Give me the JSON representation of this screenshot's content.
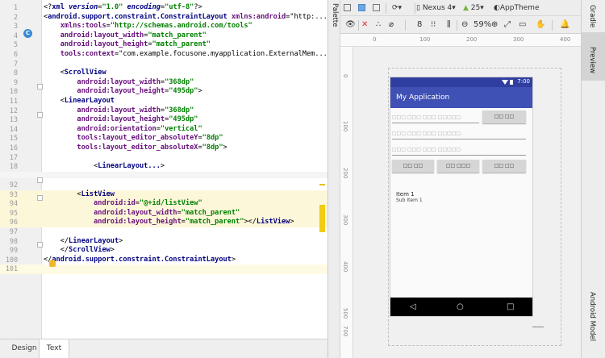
{
  "editor": {
    "lines": [
      {
        "n": "1",
        "code": "<?xml version=\"1.0\" encoding=\"utf-8\"?>"
      },
      {
        "n": "2",
        "code": "<android.support.constraint.ConstraintLayout xmlns:android=\"http:..."
      },
      {
        "n": "3",
        "code": "    xmlns:tools=\"http://schemas.android.com/tools\""
      },
      {
        "n": "4",
        "code": "    android:layout_width=\"match_parent\""
      },
      {
        "n": "5",
        "code": "    android:layout_height=\"match_parent\""
      },
      {
        "n": "6",
        "code": "    tools:context=\"com.example.focusone.myapplication.ExternalMem..."
      },
      {
        "n": "7",
        "code": ""
      },
      {
        "n": "8",
        "code": "    <ScrollView"
      },
      {
        "n": "9",
        "code": "        android:layout_width=\"368dp\""
      },
      {
        "n": "10",
        "code": "        android:layout_height=\"495dp\">"
      },
      {
        "n": "11",
        "code": "    <LinearLayout"
      },
      {
        "n": "12",
        "code": "        android:layout_width=\"368dp\""
      },
      {
        "n": "13",
        "code": "        android:layout_height=\"495dp\""
      },
      {
        "n": "14",
        "code": "        android:orientation=\"vertical\""
      },
      {
        "n": "15",
        "code": "        tools:layout_editor_absoluteY=\"8dp\""
      },
      {
        "n": "16",
        "code": "        tools:layout_editor_absoluteX=\"8dp\">"
      },
      {
        "n": "17",
        "code": ""
      },
      {
        "n": "18",
        "code": "            <LinearLayout...>"
      },
      {
        "n": "92",
        "code": ""
      },
      {
        "n": "93",
        "code": "        <ListView"
      },
      {
        "n": "94",
        "code": "            android:id=\"@+id/listView\""
      },
      {
        "n": "95",
        "code": "            android:layout_width=\"match_parent\""
      },
      {
        "n": "96",
        "code": "            android:layout_height=\"match_parent\"></ListView>"
      },
      {
        "n": "97",
        "code": ""
      },
      {
        "n": "98",
        "code": "    </LinearLayout>"
      },
      {
        "n": "99",
        "code": "    </ScrollView>"
      },
      {
        "n": "100",
        "code": "</android.support.constraint.ConstraintLayout>"
      },
      {
        "n": "101",
        "code": ""
      }
    ]
  },
  "bottom_tabs": {
    "design": "Design",
    "text": "Text"
  },
  "side_tabs": {
    "palette": "Palette",
    "gradle": "Gradle",
    "preview": "Preview",
    "android_model": "Android Model"
  },
  "toolbar": {
    "device": "Nexus 4",
    "api": "25",
    "theme": "AppTheme",
    "margin": "8",
    "zoom": "59%"
  },
  "ruler": {
    "top": [
      "0",
      "100",
      "200",
      "300",
      "400"
    ],
    "left": [
      "0",
      "100",
      "200",
      "300",
      "400",
      "500",
      "600",
      "700"
    ]
  },
  "phone": {
    "time": "7:00",
    "app_title": "My Application",
    "edit_hints": [
      "□□□ □□□ □□□ □□□□□.",
      "□□□ □□□ □□□ □□□□□.",
      "□□□ □□□ □□□ □□□□□."
    ],
    "side_button": "□□ □□",
    "buttons": [
      "□□ □□",
      "□□ □□□",
      "□□ □□"
    ],
    "list_item_title": "Item 1",
    "list_item_sub": "Sub Item 1"
  },
  "colors": {
    "app_bar": "#3f51b5",
    "status_bar": "#303f9f",
    "highlight_line": "#fdf7d9",
    "error_mark": "#f0cc15"
  }
}
